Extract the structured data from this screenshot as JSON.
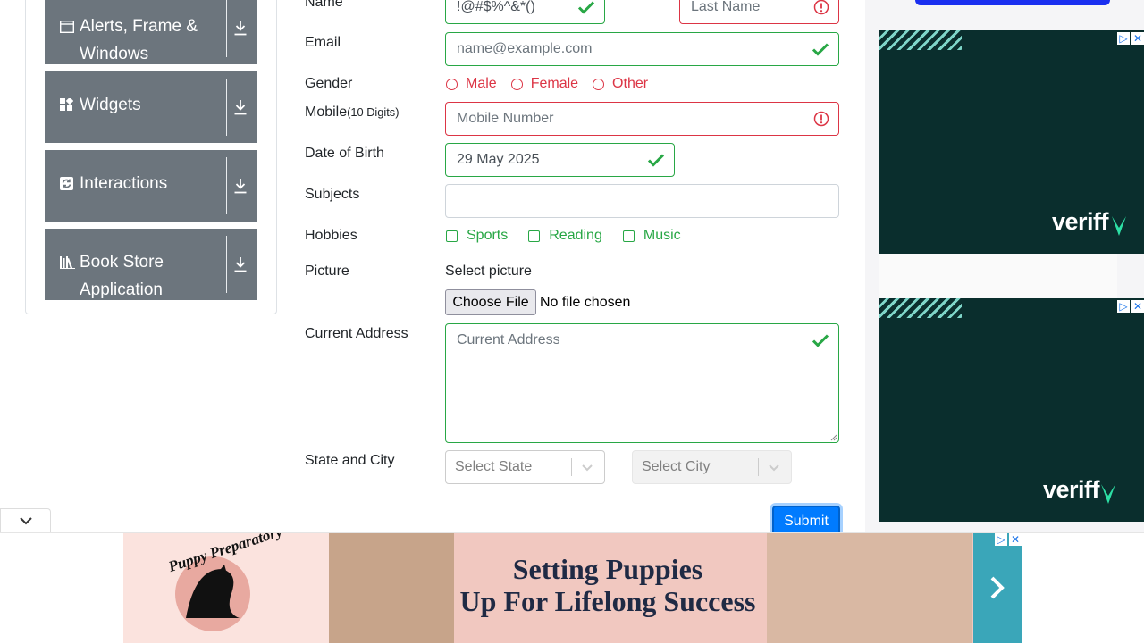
{
  "sidebar": {
    "groups": [
      {
        "label_line1": "Alerts, Frame &",
        "label_line2": "Windows",
        "icon": "window-icon"
      },
      {
        "label": "Widgets",
        "icon": "widgets-icon"
      },
      {
        "label": "Interactions",
        "icon": "interactions-icon"
      },
      {
        "label_line1": "Book Store",
        "label_line2": "Application",
        "icon": "books-icon"
      }
    ]
  },
  "form": {
    "name_label": "Name",
    "first_name_value": "!@#$%^&*()",
    "last_name_placeholder": "Last Name",
    "email_label": "Email",
    "email_placeholder": "name@example.com",
    "gender_label": "Gender",
    "gender_options": [
      "Male",
      "Female",
      "Other"
    ],
    "mobile_label": "Mobile",
    "mobile_hint": "(10 Digits)",
    "mobile_placeholder": "Mobile Number",
    "dob_label": "Date of Birth",
    "dob_value": "29 May 2025",
    "subjects_label": "Subjects",
    "hobbies_label": "Hobbies",
    "hobbies_options": [
      "Sports",
      "Reading",
      "Music"
    ],
    "picture_label": "Picture",
    "picture_prompt": "Select picture",
    "choose_file_label": "Choose File",
    "no_file_text": "No file chosen",
    "address_label": "Current Address",
    "address_placeholder": "Current Address",
    "state_city_label": "State and City",
    "state_placeholder": "Select State",
    "city_placeholder": "Select City",
    "submit_label": "Submit"
  },
  "ads": {
    "veriff_brand": "veriff",
    "banner_brand": "Puppy Preparatory",
    "banner_line1": "Setting Puppies",
    "banner_line2": "Up For Lifelong Success"
  },
  "colors": {
    "valid": "#28a745",
    "invalid": "#dc3545",
    "primary": "#007bff",
    "sidebar_group": "#6c757d"
  }
}
